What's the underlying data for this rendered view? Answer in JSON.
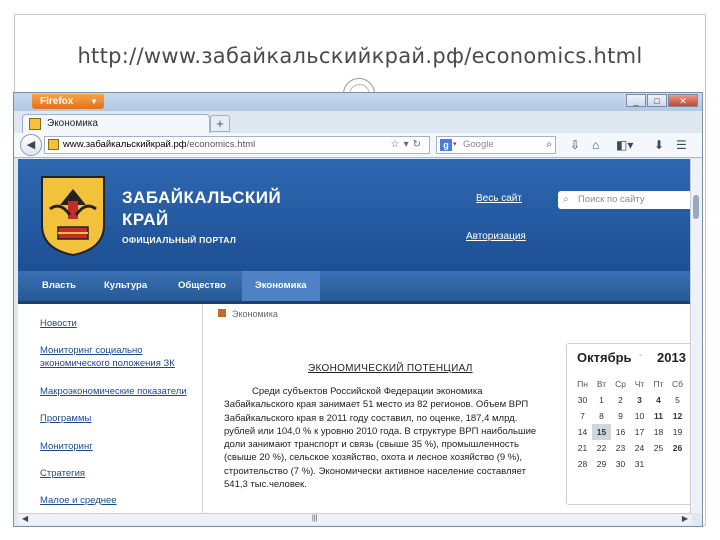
{
  "slide": {
    "title": "http://www.забайкальскийкрай.рф/economics.html"
  },
  "browser": {
    "menu_button": "Firefox",
    "tab_title": "Экономика",
    "new_tab": "+",
    "url_domain": "www.забайкальскийкрай.рф",
    "url_path": "/economics.html",
    "search_engine": "Google",
    "window_controls": [
      "_",
      "□",
      "✕"
    ]
  },
  "site": {
    "name_line1": "ЗАБАЙКАЛЬСКИЙ",
    "name_line2": "КРАЙ",
    "subtitle": "ОФИЦИАЛЬНЫЙ ПОРТАЛ",
    "whole_site_link": "Весь сайт",
    "login_link": "Авторизация",
    "search_placeholder": "Поиск по сайту",
    "menu": [
      "Власть",
      "Культура",
      "Общество",
      "Экономика"
    ],
    "active_menu": "Экономика",
    "sidebar": [
      "Новости",
      "Мониторинг социально",
      "экономического положения ЗК",
      "Макроэкономические показатели",
      "Программы",
      "Мониторинг",
      "Стратегия",
      "Малое и среднее"
    ],
    "breadcrumb": "Экономика",
    "content_heading": "ЭКОНОМИЧЕСКИЙ ПОТЕНЦИАЛ",
    "content_text": "Среди субъектов Российской Федерации экономика Забайкальского края занимает 51 место из 82 регионов. Объем ВРП Забайкальского края в 2011 году составил, по оценке, 187,4 млрд. рублей или 104,0 % к уровню 2010 года. В структуре ВРП наибольшие доли занимают транспорт и связь (свыше 35 %), промышленность (свыше 20 %), сельское хозяйство, охота и лесное хозяйство (9 %), строительство (7 %). Экономически активное население составляет 541,3 тыс.человек."
  },
  "calendar": {
    "month": "Октябрь",
    "year": "2013",
    "weekdays": [
      "Пн",
      "Вт",
      "Ср",
      "Чт",
      "Пт",
      "Сб"
    ],
    "weeks": [
      [
        "30",
        "1",
        "2",
        "3",
        "4",
        "5"
      ],
      [
        "7",
        "8",
        "9",
        "10",
        "11",
        "12"
      ],
      [
        "14",
        "15",
        "16",
        "17",
        "18",
        "19"
      ],
      [
        "21",
        "22",
        "23",
        "24",
        "25",
        "26"
      ],
      [
        "28",
        "29",
        "30",
        "31",
        "",
        ""
      ]
    ],
    "today": "15"
  }
}
